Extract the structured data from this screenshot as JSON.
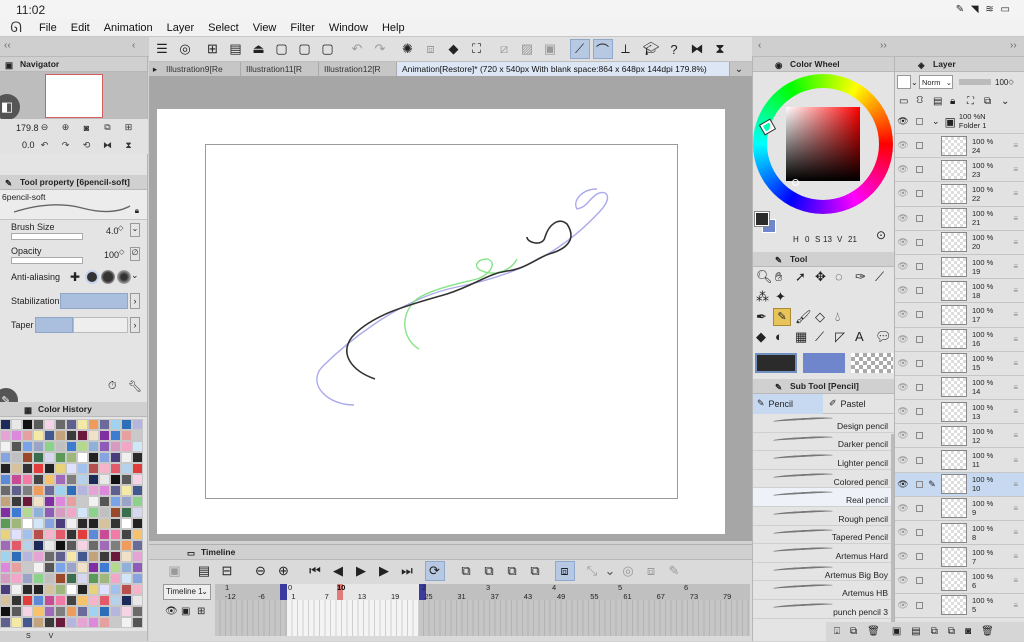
{
  "status_bar": {
    "time": "11:02"
  },
  "menu": {
    "items": [
      "File",
      "Edit",
      "Animation",
      "Layer",
      "Select",
      "View",
      "Filter",
      "Window",
      "Help"
    ]
  },
  "navigator": {
    "title": "Navigator",
    "zoom": "179.8",
    "angle": "0.0"
  },
  "tool_property": {
    "title": "Tool property [6pencil-soft]",
    "brush_name": "6pencil-soft",
    "brush_size_label": "Brush Size",
    "brush_size_value": "4.0",
    "opacity_label": "Opacity",
    "opacity_value": "100",
    "anti_aliasing_label": "Anti-aliasing",
    "stabilization_label": "Stabilization",
    "taper_label": "Taper"
  },
  "color_history": {
    "title": "Color History"
  },
  "tabs": [
    "Illustration9[Re",
    "Illustration11[R",
    "Illustration12[R",
    "Animation[Restore]* (720 x 540px With blank space:864 x 648px 144dpi 179.8%)"
  ],
  "timeline": {
    "title": "Timeline",
    "selector": "Timeline 1",
    "ruler_top": [
      "1",
      "0",
      "10",
      "2",
      "3",
      "4",
      "5",
      "6"
    ],
    "ruler_bottom": [
      "-12",
      "-6",
      "1",
      "7",
      "13",
      "19",
      "25",
      "31",
      "37",
      "43",
      "49",
      "55",
      "61",
      "67",
      "73",
      "79"
    ]
  },
  "color_wheel": {
    "title": "Color Wheel",
    "h_label": "H",
    "h_value": "0",
    "s_label": "S",
    "s_value": "13",
    "v_label": "V",
    "v_value": "21"
  },
  "tool_palette": {
    "title": "Tool"
  },
  "sub_tool": {
    "title": "Sub Tool [Pencil]",
    "tab_pencil": "Pencil",
    "tab_pastel": "Pastel",
    "brushes": [
      "Design pencil",
      "Darker pencil",
      "Lighter pencil",
      "Colored pencil",
      "Real pencil",
      "Rough pencil",
      "Tapered Pencil",
      "Artemus Hard",
      "Artemus Big Boy",
      "Artemus HB",
      "punch pencil 3"
    ]
  },
  "layer_panel": {
    "title": "Layer",
    "blend_mode": "Norm",
    "opacity": "100",
    "folder": {
      "percent": "100 %N",
      "name": "Folder 1"
    },
    "layers": [
      {
        "percent": "100 %",
        "name": "24"
      },
      {
        "percent": "100 %",
        "name": "23"
      },
      {
        "percent": "100 %",
        "name": "22"
      },
      {
        "percent": "100 %",
        "name": "21"
      },
      {
        "percent": "100 %",
        "name": "20"
      },
      {
        "percent": "100 %",
        "name": "19"
      },
      {
        "percent": "100 %",
        "name": "18"
      },
      {
        "percent": "100 %",
        "name": "17"
      },
      {
        "percent": "100 %",
        "name": "16"
      },
      {
        "percent": "100 %",
        "name": "15"
      },
      {
        "percent": "100 %",
        "name": "14"
      },
      {
        "percent": "100 %",
        "name": "13"
      },
      {
        "percent": "100 %",
        "name": "12"
      },
      {
        "percent": "100 %",
        "name": "11"
      },
      {
        "percent": "100 %",
        "name": "10"
      },
      {
        "percent": "100 %",
        "name": "9"
      },
      {
        "percent": "100 %",
        "name": "8"
      },
      {
        "percent": "100 %",
        "name": "7"
      },
      {
        "percent": "100 %",
        "name": "6"
      },
      {
        "percent": "100 %",
        "name": "5"
      }
    ]
  },
  "colors": {
    "accent": "#2f6fd6",
    "main_color": "#2b2b2b",
    "sub_color": "#6f86cc",
    "selection": "#c7d9f0"
  }
}
